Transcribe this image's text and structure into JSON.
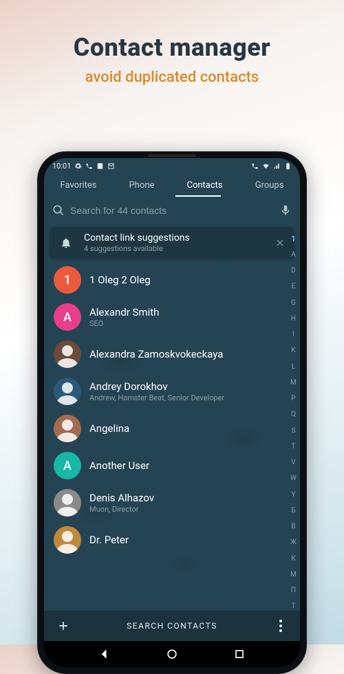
{
  "promo": {
    "title": "Contact manager",
    "subtitle": "avoid duplicated contacts"
  },
  "statusbar": {
    "time": "10:01"
  },
  "tabs": [
    "Favorites",
    "Phone",
    "Contacts",
    "Groups"
  ],
  "active_tab_index": 2,
  "search": {
    "placeholder": "Search for 44 contacts"
  },
  "suggestion": {
    "title": "Contact link suggestions",
    "subtitle": "4 suggestions available"
  },
  "contacts": [
    {
      "name": "1 Oleg 2 Oleg",
      "sub": "",
      "avatar_type": "letter",
      "letter": "1",
      "color": "#eb5a3c"
    },
    {
      "name": "Alexandr Smith",
      "sub": "SEO",
      "avatar_type": "letter",
      "letter": "A",
      "color": "#e83e8c"
    },
    {
      "name": "Alexandra Zamoskvokeckaya",
      "sub": "",
      "avatar_type": "face",
      "color": "#6b4b3a"
    },
    {
      "name": "Andrey Dorokhov",
      "sub": "Andrew, Hamster Beat, Senior Developer",
      "avatar_type": "face",
      "color": "#2a5a78"
    },
    {
      "name": "Angelina",
      "sub": "",
      "avatar_type": "face",
      "color": "#a36b50"
    },
    {
      "name": "Another User",
      "sub": "",
      "avatar_type": "letter",
      "letter": "A",
      "color": "#17b8a6"
    },
    {
      "name": "Denis Alhazov",
      "sub": "Muon, Director",
      "avatar_type": "face",
      "color": "#8a8a8a"
    },
    {
      "name": "Dr. Peter",
      "sub": "",
      "avatar_type": "face",
      "color": "#c18a3a"
    }
  ],
  "az_index": [
    "1",
    "A",
    "D",
    "E",
    "G",
    "H",
    "I",
    "K",
    "L",
    "M",
    "P",
    "Q",
    "S",
    "T",
    "V",
    "W",
    "Y",
    "Б",
    "В",
    "Ж",
    "К",
    "М",
    "П",
    "Т"
  ],
  "az_active": "1",
  "bottombar": {
    "center_label": "SEARCH CONTACTS"
  }
}
